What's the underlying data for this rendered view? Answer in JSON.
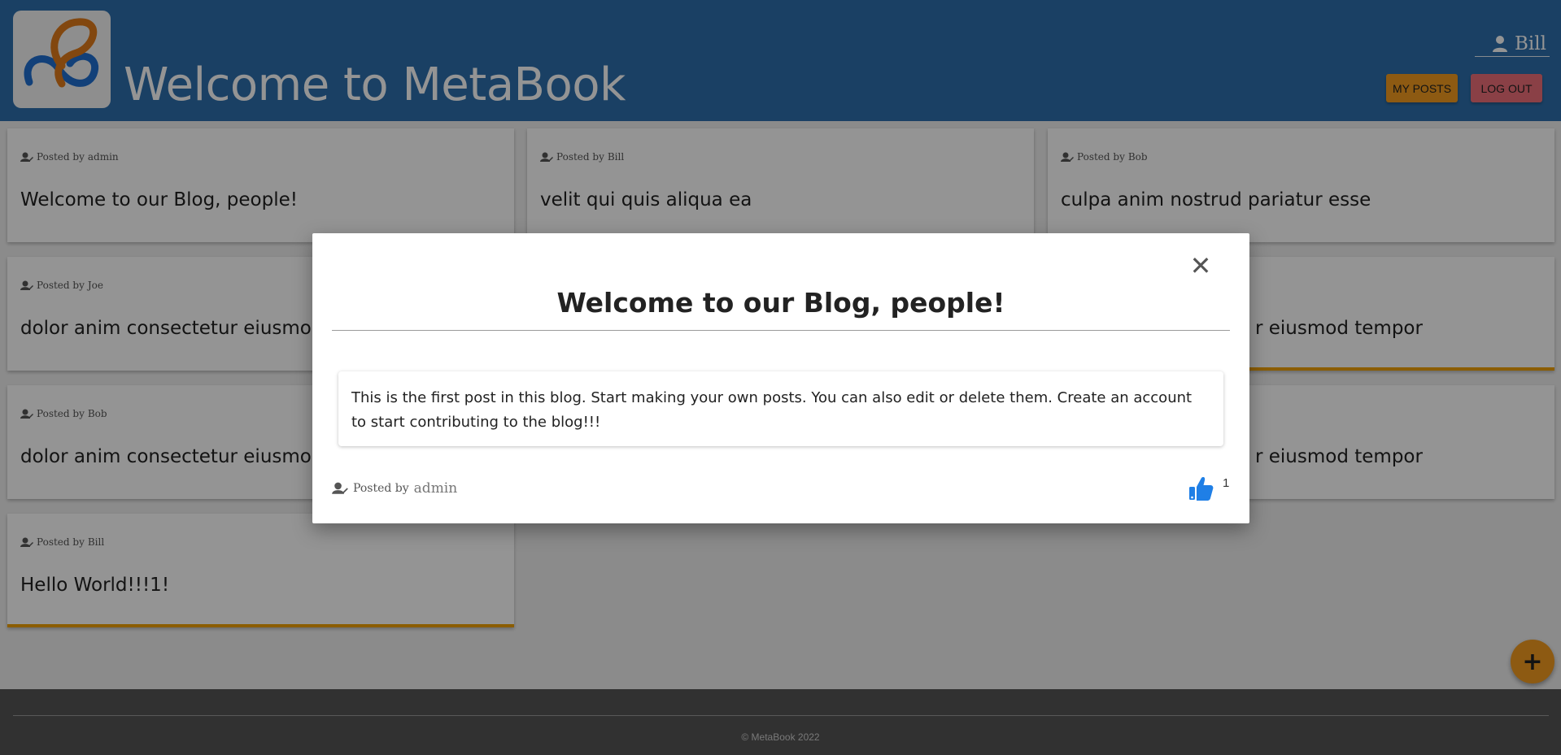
{
  "header": {
    "title": "Welcome to MetaBook",
    "user_name": "Bill",
    "my_posts_label": "MY POSTS",
    "logout_label": "LOG OUT"
  },
  "posts": [
    {
      "posted_by_label": "Posted by",
      "author": "admin",
      "title": "Welcome to our Blog, people!"
    },
    {
      "posted_by_label": "Posted by",
      "author": "Bill",
      "title": "velit qui quis aliqua ea"
    },
    {
      "posted_by_label": "Posted by",
      "author": "Bob",
      "title": "culpa anim nostrud pariatur esse"
    },
    {
      "posted_by_label": "Posted by",
      "author": "Joe",
      "title": "dolor anim consectetur eiusmod tempor"
    },
    {
      "title_visible_fragment": "r eiusmod tempor"
    },
    {
      "posted_by_label": "Posted by",
      "author": "Bob",
      "title": "dolor anim consectetur eiusmod tempor"
    },
    {
      "title_visible_fragment": "r eiusmod tempor"
    },
    {
      "posted_by_label": "Posted by",
      "author": "Bill",
      "title": "Hello World!!!1!"
    }
  ],
  "modal": {
    "title": "Welcome to our Blog, people!",
    "body": "This is the first post in this blog. Start making your own posts. You can also edit or delete them. Create an account to start contributing to the blog!!!",
    "posted_by_label": "Posted by",
    "author": "admin",
    "close_symbol": "✕",
    "like_count": "1"
  },
  "footer": {
    "copyright": "© MetaBook 2022"
  },
  "fab": {
    "symbol": "+"
  },
  "colors": {
    "header_bg": "#2d6fad",
    "accent_orange": "#f39c1f",
    "logout_red": "#ee6f79",
    "footer_bg": "#555555",
    "like_blue": "#1f7fe6"
  },
  "icons": {
    "user": "user-icon",
    "author": "user-edit-icon",
    "like": "thumbs-up-icon",
    "close": "close-icon",
    "add": "plus-icon"
  }
}
